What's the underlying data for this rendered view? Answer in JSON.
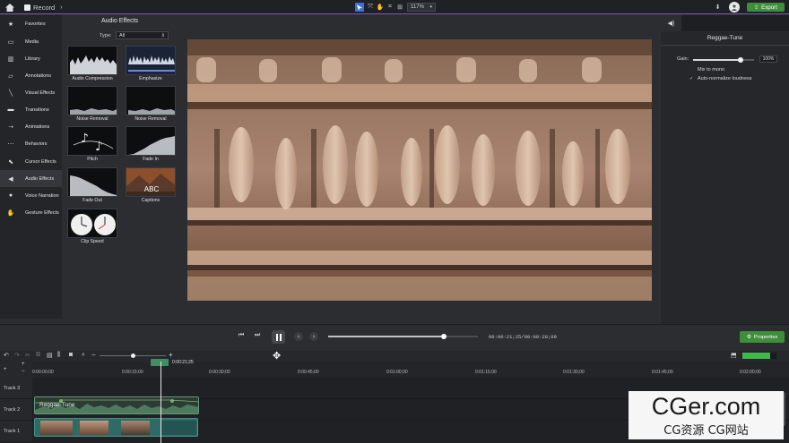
{
  "app": {
    "title": "Record",
    "zoom": "117%",
    "export_label": "Export"
  },
  "sidebar": {
    "items": [
      {
        "label": "Favorites",
        "icon": "star-icon",
        "glyph": "★"
      },
      {
        "label": "Media",
        "icon": "media-icon",
        "glyph": "▭"
      },
      {
        "label": "Library",
        "icon": "library-icon",
        "glyph": "▥"
      },
      {
        "label": "Annotations",
        "icon": "annotation-icon",
        "glyph": "▱"
      },
      {
        "label": "Visual Effects",
        "icon": "wand-icon",
        "glyph": "╲"
      },
      {
        "label": "Transitions",
        "icon": "transition-icon",
        "glyph": "▬"
      },
      {
        "label": "Animations",
        "icon": "animation-icon",
        "glyph": "➝"
      },
      {
        "label": "Behaviors",
        "icon": "behavior-icon",
        "glyph": "⋯"
      },
      {
        "label": "Cursor Effects",
        "icon": "cursor-icon",
        "glyph": "⬉"
      },
      {
        "label": "Audio Effects",
        "icon": "speaker-icon",
        "glyph": "◀"
      },
      {
        "label": "Voice Narration",
        "icon": "microphone-icon",
        "glyph": "●"
      },
      {
        "label": "Gesture Effects",
        "icon": "gesture-icon",
        "glyph": "✋"
      }
    ]
  },
  "effects_panel": {
    "title": "Audio Effects",
    "type_label": "Type:",
    "type_value": "All",
    "tiles": [
      {
        "label": "Audio Compression"
      },
      {
        "label": "Emphasize"
      },
      {
        "label": "Noise Removal"
      },
      {
        "label": "Noise Removal"
      },
      {
        "label": "Pitch"
      },
      {
        "label": "Fade In"
      },
      {
        "label": "Fade Out"
      },
      {
        "label": "Captions",
        "overlay": "ABC"
      },
      {
        "label": "Clip Speed"
      }
    ]
  },
  "properties": {
    "title": "Reggae-Tune",
    "gain_label": "Gain:",
    "gain_value": "100%",
    "gain_level": 0.78,
    "mix_to_mono": "Mix to mono",
    "mix_to_mono_checked": false,
    "auto_normalize": "Auto-normalize loudness",
    "auto_normalize_checked": true,
    "button_label": "Properties"
  },
  "playback": {
    "time": "00:00:21;25/00:00:28;09",
    "progress": 0.77
  },
  "timeline": {
    "playhead_time": "0:00:21;25",
    "ruler": [
      "0:00:00;00",
      "0:00:15;00",
      "0:00:30;00",
      "0:00:45;00",
      "0:01:00;00",
      "0:01:15;00",
      "0:01:30;00",
      "0:01:45;00",
      "0:02:00;00"
    ],
    "tracks": [
      "Track 3",
      "Track 2",
      "Track 1"
    ],
    "audio_clip": "Reggae-Tune",
    "zoom_minus": "−",
    "zoom_plus": "+"
  },
  "watermark": {
    "title": "CGer.com",
    "subtitle": "CG资源 CG网站"
  },
  "colors": {
    "accent": "#7a55c6",
    "export_green": "#3e8e3a",
    "clip_teal": "#2f6b66",
    "audio_green": "#79b36c"
  }
}
